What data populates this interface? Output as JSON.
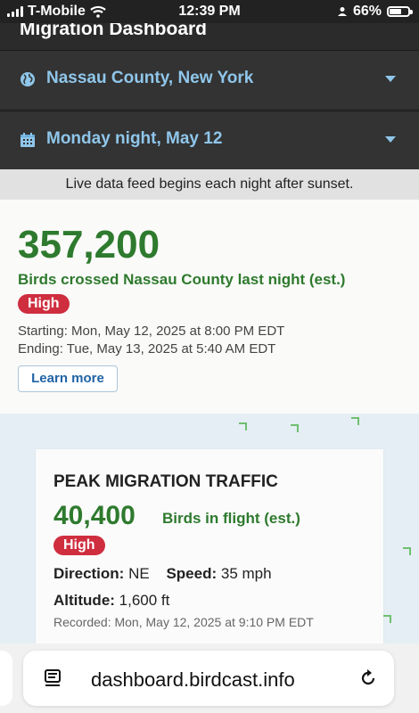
{
  "status_bar": {
    "carrier": "T-Mobile",
    "time": "12:39 PM",
    "battery": "66%",
    "battery_level": 0.66
  },
  "header": {
    "title": "Migration Dashboard"
  },
  "location_selector": {
    "label": "Nassau County, New York",
    "icon": "globe-icon"
  },
  "date_selector": {
    "label": "Monday night, May 12",
    "icon": "calendar-icon"
  },
  "notice": "Live data feed begins each night after sunset.",
  "last_night": {
    "count": "357,200",
    "description": "Birds crossed Nassau County last night (est.)",
    "level": "High",
    "starting": "Starting: Mon, May 12, 2025 at 8:00 PM EDT",
    "ending": "Ending: Tue, May 13, 2025 at 5:40 AM EDT",
    "learn_more": "Learn more"
  },
  "peak": {
    "title": "PEAK MIGRATION TRAFFIC",
    "count": "40,400",
    "count_label": "Birds in flight (est.)",
    "level": "High",
    "direction_label": "Direction:",
    "direction_value": "NE",
    "speed_label": "Speed:",
    "speed_value": "35 mph",
    "altitude_label": "Altitude:",
    "altitude_value": "1,600 ft",
    "recorded": "Recorded: Mon, May 12, 2025 at 9:10 PM EDT"
  },
  "browser": {
    "url": "dashboard.birdcast.info"
  },
  "colors": {
    "accent_green": "#2e7a2e",
    "badge_red": "#cf2e3f",
    "selector_text": "#8fc6ea",
    "link_blue": "#1f63a5"
  }
}
